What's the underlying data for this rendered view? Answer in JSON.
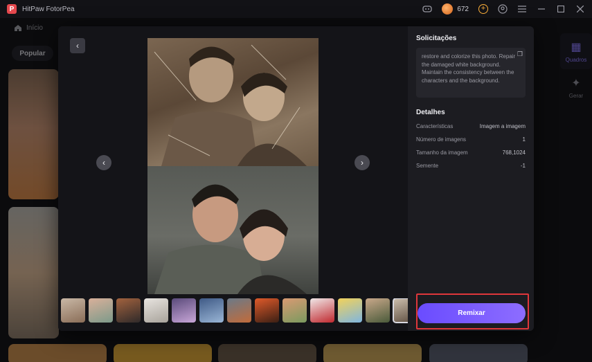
{
  "app": {
    "title": "HitPaw FotorPea",
    "credits": "672"
  },
  "nav": {
    "home_label": "Início",
    "filter_label": "Popular"
  },
  "right_nav": [
    {
      "label": "Quadros",
      "icon": "grid-icon"
    },
    {
      "label": "Gerar",
      "icon": "sparkle-icon"
    }
  ],
  "panel": {
    "prompt_title": "Solicitações",
    "prompt_text": "restore and colorize this photo. Repair the damaged white background. Maintain the consistency between the characters and the background.",
    "details_title": "Detalhes",
    "details": [
      {
        "label": "Características",
        "value": "Imagem a imagem"
      },
      {
        "label": "Número de imagens",
        "value": "1"
      },
      {
        "label": "Tamanho da imagem",
        "value": "768,1024"
      },
      {
        "label": "Semente",
        "value": "-1"
      }
    ],
    "remix_label": "Remixar"
  },
  "colors": {
    "accent": "#7b5cff",
    "highlight": "#e0373b",
    "coin": "#e27a2a"
  },
  "thumbnails": [
    {
      "colors": [
        "#c9b8a6",
        "#8a6d57"
      ]
    },
    {
      "colors": [
        "#d9b09a",
        "#7c9a8a"
      ]
    },
    {
      "colors": [
        "#a2623e",
        "#2f2a2a"
      ]
    },
    {
      "colors": [
        "#e8e4e0",
        "#a8a39b"
      ]
    },
    {
      "colors": [
        "#5a4a7a",
        "#c9a7d9"
      ]
    },
    {
      "colors": [
        "#3f5a86",
        "#9ab6d6"
      ]
    },
    {
      "colors": [
        "#6b7a88",
        "#c26b3a"
      ]
    },
    {
      "colors": [
        "#e05a2a",
        "#3a1f14"
      ]
    },
    {
      "colors": [
        "#d99a73",
        "#7a9a5f"
      ]
    },
    {
      "colors": [
        "#f0e8e8",
        "#c0282e"
      ]
    },
    {
      "colors": [
        "#f2d25a",
        "#7fb6e0"
      ]
    },
    {
      "colors": [
        "#c9a88a",
        "#4a5a3a"
      ]
    },
    {
      "colors": [
        "#cdbfae",
        "#5a4a3c"
      ]
    }
  ]
}
